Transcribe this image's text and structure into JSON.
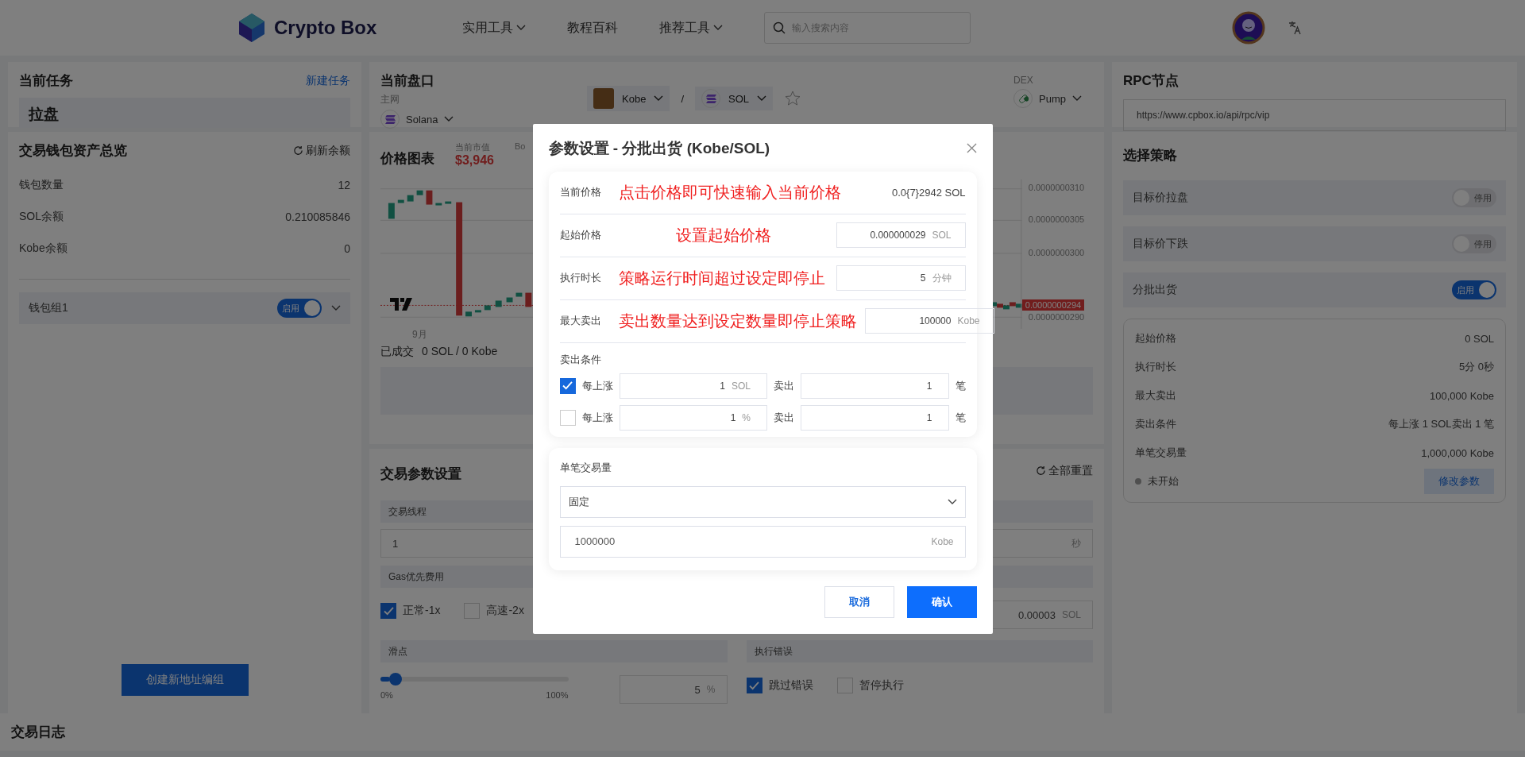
{
  "header": {
    "logo_text": "Crypto Box",
    "nav": [
      {
        "label": "实用工具",
        "dropdown": true
      },
      {
        "label": "教程百科",
        "dropdown": false
      },
      {
        "label": "推荐工具",
        "dropdown": true
      }
    ],
    "search": {
      "placeholder": "输入搜索内容"
    }
  },
  "current_task": {
    "title": "当前任务",
    "action": "新建任务",
    "task": "拉盘"
  },
  "wallet_overview": {
    "title": "交易钱包资产总览",
    "refresh": "刷新余额",
    "stats": [
      {
        "label": "钱包数量",
        "value": "12"
      },
      {
        "label": "SOL余额",
        "value": "0.210085846"
      },
      {
        "label": "Kobe余额",
        "value": "0"
      }
    ],
    "groups": [
      {
        "name": "钱包组1",
        "on": true,
        "toggle_label": "启用"
      }
    ],
    "create_button": "创建新地址编组"
  },
  "market": {
    "title": "当前盘口",
    "network": {
      "label": "主网",
      "value": "Solana"
    },
    "pair": {
      "base": "Kobe",
      "separator": "/",
      "quote": "SOL",
      "starred": false
    },
    "dex": {
      "label": "DEX",
      "value": "Pump"
    }
  },
  "price_chart": {
    "title": "价格图表",
    "market_cap": {
      "label": "当前市值",
      "value": "$3,946"
    },
    "legend_cut": "Bo",
    "price_axis": [
      "0.0000000310",
      "0.0000000305",
      "0.0000000300",
      "0.0000000290"
    ],
    "current_price": "0.0000000294",
    "x_label": "9月",
    "traded": {
      "label": "已成交",
      "value": "0 SOL / 0 Kobe"
    }
  },
  "trade_params": {
    "title": "交易参数设置",
    "reset": "全部重置",
    "threads": {
      "label": "交易线程",
      "value": "1"
    },
    "interval": {
      "unit": "秒"
    },
    "gas": {
      "label": "Gas优先费用",
      "options": [
        {
          "label": "正常-1x",
          "checked": true
        },
        {
          "label": "高速-2x",
          "checked": false
        }
      ],
      "custom": {
        "value": "0.00003",
        "unit": "SOL"
      }
    },
    "slippage": {
      "label": "滑点",
      "level": 0.05,
      "min": "0%",
      "max": "100%",
      "value": "5",
      "unit": "%"
    },
    "errors": {
      "label": "执行错误",
      "options": [
        {
          "label": "跳过错误",
          "checked": true
        },
        {
          "label": "暂停执行",
          "checked": false
        }
      ]
    }
  },
  "rpc": {
    "title": "RPC节点",
    "value": "https://www.cpbox.io/api/rpc/vip"
  },
  "strategy": {
    "title": "选择策略",
    "items": [
      {
        "name": "目标价拉盘",
        "on": false,
        "toggle_label": "停用"
      },
      {
        "name": "目标价下跌",
        "on": false,
        "toggle_label": "停用"
      },
      {
        "name": "分批出货",
        "on": true,
        "toggle_label": "启用"
      }
    ],
    "summary": [
      {
        "label": "起始价格",
        "value": "0 SOL"
      },
      {
        "label": "执行时长",
        "value": "5分 0秒"
      },
      {
        "label": "最大卖出",
        "value": "100,000 Kobe"
      },
      {
        "label": "卖出条件",
        "value": "每上涨 1 SOL卖出 1 笔"
      },
      {
        "label": "单笔交易量",
        "value": "1,000,000 Kobe"
      }
    ],
    "status": {
      "label": "未开始"
    },
    "edit_button": "修改参数"
  },
  "trade_log": {
    "title": "交易日志"
  },
  "modal": {
    "title": "参数设置 - 分批出货 (Kobe/SOL)",
    "rows": [
      {
        "kind": "readout",
        "label": "当前价格",
        "note": "点击价格即可快速输入当前价格",
        "value": "0.0{7}2942 SOL"
      },
      {
        "kind": "input",
        "label": "起始价格",
        "note": "设置起始价格",
        "value": "0.000000029",
        "unit": "SOL"
      },
      {
        "kind": "input",
        "label": "执行时长",
        "note": "策略运行时间超过设定即停止",
        "value": "5",
        "unit": "分钟"
      },
      {
        "kind": "input",
        "label": "最大卖出",
        "note": "卖出数量达到设定数量即停止策略",
        "value": "100000",
        "unit": "Kobe"
      }
    ],
    "conditions": {
      "label": "卖出条件",
      "items": [
        {
          "checked": true,
          "label": "每上涨",
          "amount": "1",
          "unit": "SOL",
          "sell_label": "卖出",
          "count": "1",
          "count_unit": "笔"
        },
        {
          "checked": false,
          "label": "每上涨",
          "amount": "1",
          "unit": "%",
          "sell_label": "卖出",
          "count": "1",
          "count_unit": "笔"
        }
      ]
    },
    "volume": {
      "label": "单笔交易量",
      "mode": "固定",
      "value": "1000000",
      "unit": "Kobe"
    },
    "buttons": [
      {
        "kind": "secondary",
        "label": "取消"
      },
      {
        "kind": "primary",
        "label": "确认"
      }
    ]
  }
}
